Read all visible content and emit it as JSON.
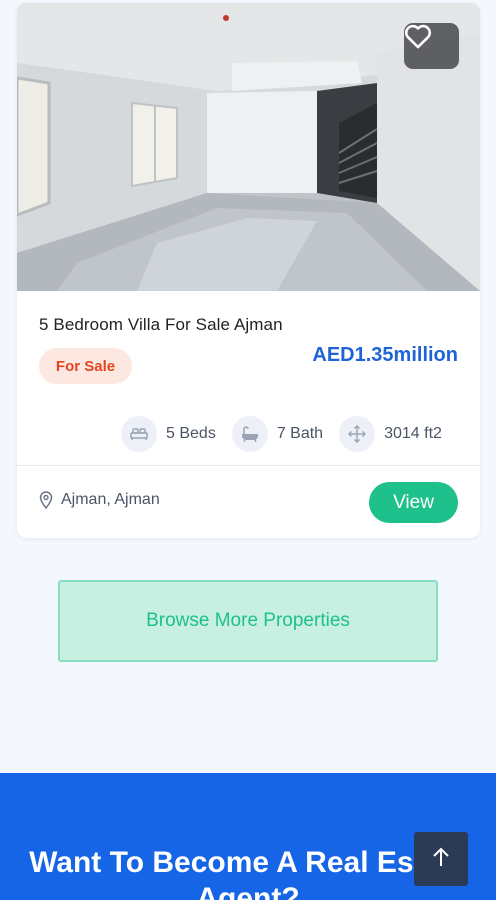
{
  "listing": {
    "title": "5 Bedroom Villa For Sale Ajman",
    "status_badge": "For Sale",
    "price": "AED1.35million",
    "features": {
      "beds": "5 Beds",
      "baths": "7 Bath",
      "area": "3014 ft2"
    },
    "location": "Ajman, Ajman",
    "view_label": "View"
  },
  "browse_label": "Browse More Properties",
  "cta": {
    "title": "Want To Become A Real Estate Agent?"
  },
  "colors": {
    "price": "#1f63d8",
    "badge_text": "#e0471e",
    "badge_bg": "#fde8e1",
    "accent_green": "#1ec08c",
    "cta_blue": "#1565e6",
    "scroll_btn": "#2b3a55"
  },
  "icons": {
    "favorite": "heart-icon",
    "beds": "bed-icon",
    "baths": "bathtub-icon",
    "area": "move-arrows-icon",
    "location": "map-pin-icon",
    "scroll_top": "arrow-up-icon"
  }
}
